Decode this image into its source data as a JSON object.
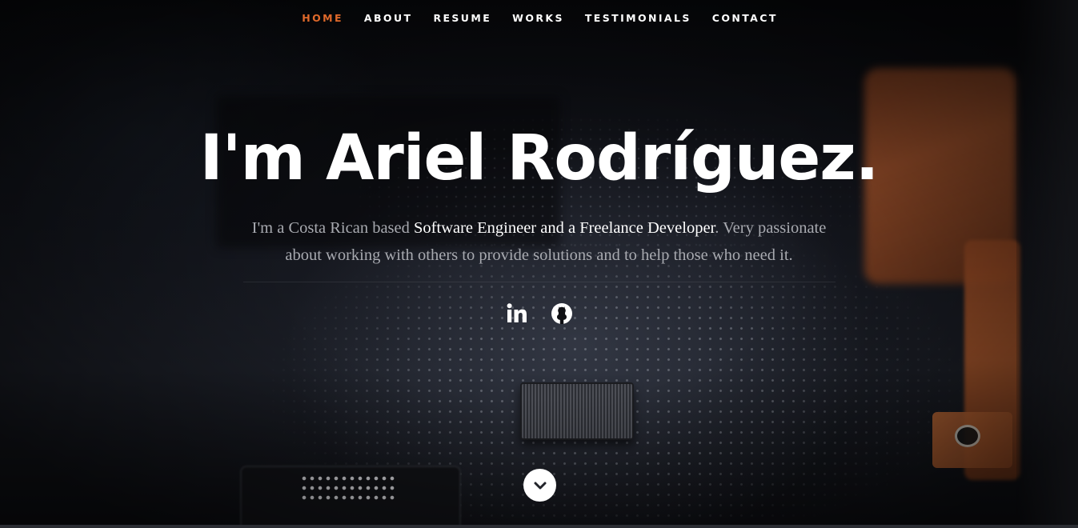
{
  "nav": {
    "items": [
      {
        "label": "HOME",
        "current": true
      },
      {
        "label": "ABOUT",
        "current": false
      },
      {
        "label": "RESUME",
        "current": false
      },
      {
        "label": "WORKS",
        "current": false
      },
      {
        "label": "TESTIMONIALS",
        "current": false
      },
      {
        "label": "CONTACT",
        "current": false
      }
    ]
  },
  "banner": {
    "headline": "I'm Ariel Rodríguez.",
    "intro": {
      "part1": "I'm a Costa Rican based ",
      "highlight": "Software Engineer and a Freelance Developer",
      "part2": ". Very passionate about working with others to provide solutions and to help those who need it."
    }
  },
  "social": [
    {
      "icon": "linkedin-icon"
    },
    {
      "icon": "github-icon"
    }
  ],
  "scroll": {
    "icon": "chevron-down-icon"
  },
  "colors": {
    "accent": "#e0692a",
    "text": "#ffffff",
    "muted": "#a8aab0"
  }
}
